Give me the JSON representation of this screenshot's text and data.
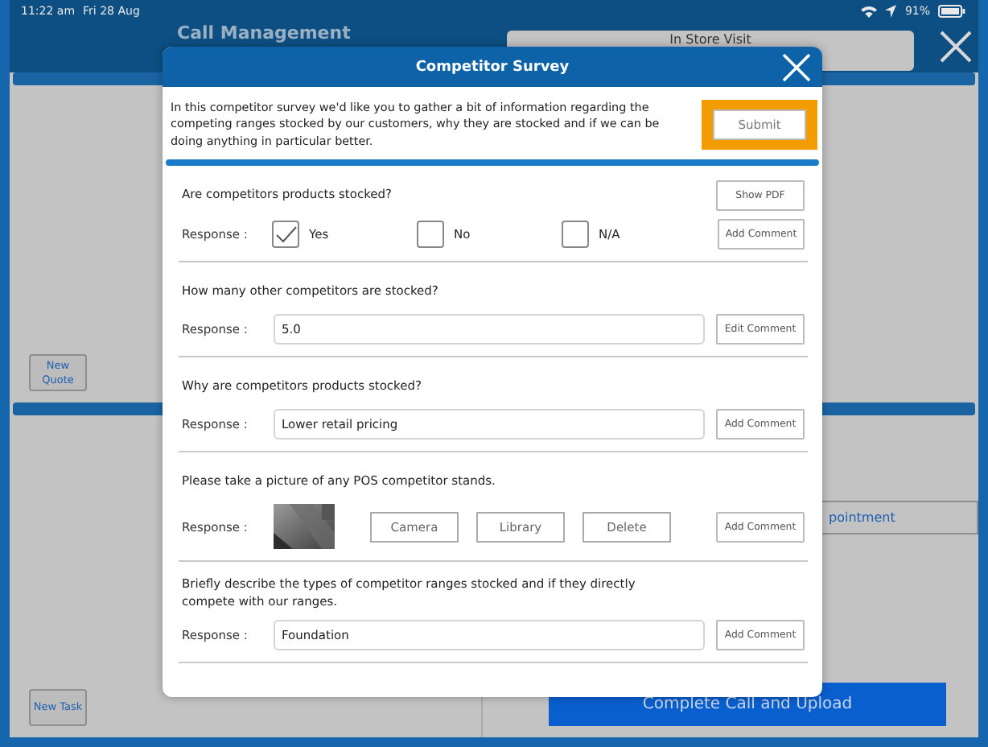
{
  "status_bar": {
    "time": "11:22 am",
    "date": "Fri 28 Aug",
    "battery": "91%"
  },
  "background": {
    "title": "Call Management",
    "tab": "In Store Visit",
    "upper_button": "New Quote",
    "lower_button": "New Task",
    "appointment_button": "pointment",
    "complete_button": "Complete Call and Upload"
  },
  "dialog": {
    "title": "Competitor Survey",
    "intro": "In this competitor survey we'd like you to gather a bit of information regarding the competing ranges stocked by our customers, why they are stocked and if we can be doing anything in particular better.",
    "submit": "Submit",
    "questions": [
      {
        "kind": "choice",
        "question": "Are competitors products stocked?",
        "top_button": "Show PDF",
        "response_label": "Response :",
        "options": [
          {
            "label": "Yes",
            "checked": true
          },
          {
            "label": "No",
            "checked": false
          },
          {
            "label": "N/A",
            "checked": false
          }
        ],
        "comment_button": "Add Comment"
      },
      {
        "kind": "text",
        "question": "How many other competitors are stocked?",
        "response_label": "Response :",
        "value": "5.0",
        "comment_button": "Edit Comment"
      },
      {
        "kind": "text",
        "question": "Why are competitors products stocked?",
        "response_label": "Response :",
        "value": "Lower retail pricing",
        "comment_button": "Add Comment"
      },
      {
        "question": "Please take a picture of any POS competitor stands.",
        "response_label": "Response :",
        "actions": [
          "Camera",
          "Library",
          "Delete"
        ],
        "comment_button": "Add Comment"
      },
      {
        "kind": "text",
        "question": "Briefly describe the types of competitor ranges stocked and if they directly compete with our ranges.",
        "response_label": "Response :",
        "value": "Foundation",
        "comment_button": "Add Comment"
      }
    ]
  }
}
